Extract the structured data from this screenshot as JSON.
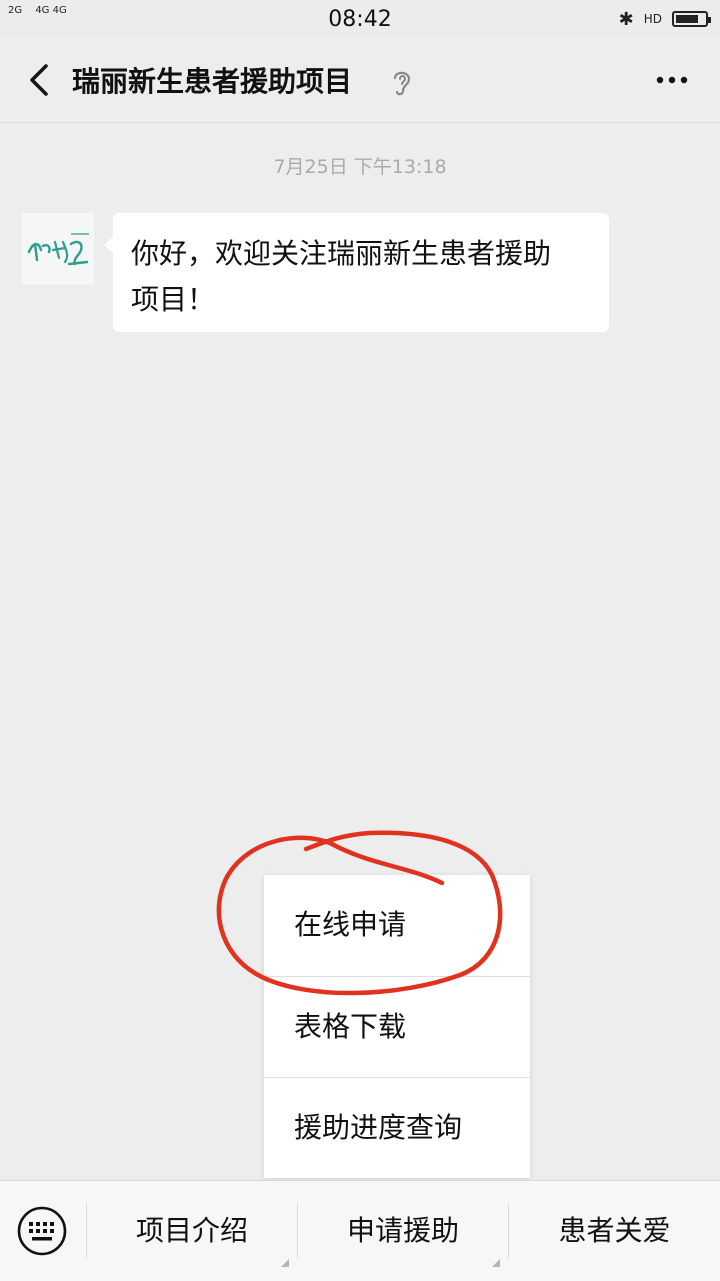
{
  "status_bar": {
    "signal_left": "2G",
    "signal_right": "4G 4G",
    "time": "08:42",
    "bluetooth_icon": "bluetooth-icon",
    "hd_label": "HD",
    "battery_level": 0.8
  },
  "header": {
    "title": "瑞丽新生患者援助项目",
    "back_icon": "chevron-left-icon",
    "ear_icon": "ear-icon",
    "more_icon": "more-dots-icon"
  },
  "chat": {
    "timestamp": "7月25日 下午13:18",
    "messages": [
      {
        "line1": "你好，欢迎关注瑞丽新生患者援助",
        "line2": "项目！"
      }
    ]
  },
  "popup_menu": {
    "items": [
      "在线申请",
      "表格下载",
      "援助进度查询"
    ],
    "annotation_color": "#e0321e"
  },
  "bottom_menu": {
    "keyboard_icon": "keyboard-icon",
    "items": [
      "项目介绍",
      "申请援助",
      "患者关爱"
    ]
  },
  "colors": {
    "background": "#ededed",
    "bubble": "#ffffff",
    "accent_red": "#e0321e",
    "logo_teal": "#2f9e8f"
  }
}
